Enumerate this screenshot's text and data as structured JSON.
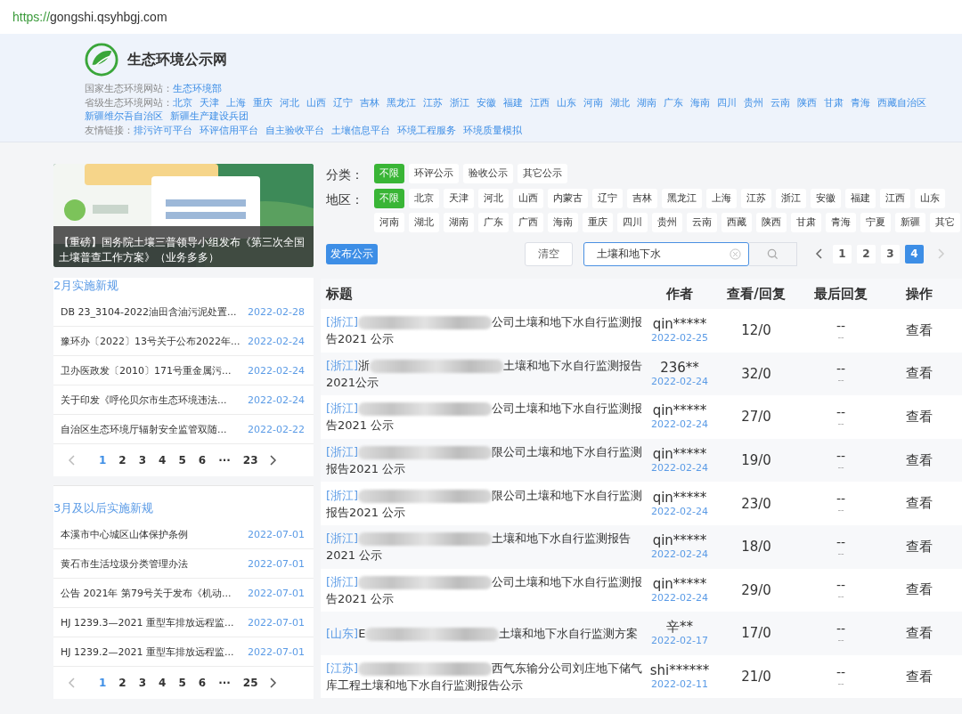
{
  "address_bar": {
    "scheme": "https://",
    "host": "gongshi.qsyhbgj.com"
  },
  "header": {
    "site_title": "生态环境公示网",
    "link_rows": [
      {
        "label": "国家生态环境网站：",
        "links": [
          "生态环境部"
        ]
      },
      {
        "label": "省级生态环境网站：",
        "links": [
          "北京",
          "天津",
          "上海",
          "重庆",
          "河北",
          "山西",
          "辽宁",
          "吉林",
          "黑龙江",
          "江苏",
          "浙江",
          "安徽",
          "福建",
          "江西",
          "山东",
          "河南",
          "湖北",
          "湖南",
          "广东",
          "海南",
          "四川",
          "贵州",
          "云南",
          "陕西",
          "甘肃",
          "青海",
          "西藏自治区",
          "新疆维尔吾自治区",
          "新疆生产建设兵团"
        ]
      },
      {
        "label": "友情链接：",
        "links": [
          "排污许可平台",
          "环评信用平台",
          "自主验收平台",
          "土壤信息平台",
          "环境工程服务",
          "环境质量模拟"
        ]
      }
    ]
  },
  "banner": {
    "caption": "【重磅】国务院土壤三普领导小组发布《第三次全国土壤普查工作方案》（业务多多）"
  },
  "sections": [
    {
      "title": "2月实施新规",
      "items": [
        {
          "title": "DB 23_3104-2022油田含油污泥处置...",
          "date": "2022-02-28"
        },
        {
          "title": "豫环办〔2022〕13号关于公布2022年...",
          "date": "2022-02-24"
        },
        {
          "title": "卫办医政发〔2010〕171号重金属污...",
          "date": "2022-02-24"
        },
        {
          "title": "关于印发《呼伦贝尔市生态环境违法...",
          "date": "2022-02-24"
        },
        {
          "title": "自治区生态环境厅辐射安全监管双随...",
          "date": "2022-02-22"
        }
      ],
      "pages": [
        {
          "label": "1",
          "selected": true
        },
        {
          "label": "2",
          "selected": false
        },
        {
          "label": "3",
          "selected": false
        },
        {
          "label": "4",
          "selected": false
        },
        {
          "label": "5",
          "selected": false
        },
        {
          "label": "6",
          "selected": false
        },
        {
          "label": "···",
          "selected": false
        },
        {
          "label": "23",
          "selected": false
        }
      ]
    },
    {
      "title": "3月及以后实施新规",
      "items": [
        {
          "title": "本溪市中心城区山体保护条例",
          "date": "2022-07-01"
        },
        {
          "title": "黄石市生活垃圾分类管理办法",
          "date": "2022-07-01"
        },
        {
          "title": "公告 2021年 第79号关于发布《机动...",
          "date": "2022-07-01"
        },
        {
          "title": "HJ 1239.3—2021 重型车排放远程监...",
          "date": "2022-07-01"
        },
        {
          "title": "HJ 1239.2—2021 重型车排放远程监...",
          "date": "2022-07-01"
        }
      ],
      "pages": [
        {
          "label": "1",
          "selected": true
        },
        {
          "label": "2",
          "selected": false
        },
        {
          "label": "3",
          "selected": false
        },
        {
          "label": "4",
          "selected": false
        },
        {
          "label": "5",
          "selected": false
        },
        {
          "label": "6",
          "selected": false
        },
        {
          "label": "···",
          "selected": false
        },
        {
          "label": "25",
          "selected": false
        }
      ]
    }
  ],
  "filters": [
    {
      "label": "分类：",
      "options": [
        {
          "label": "不限",
          "selected": true
        },
        {
          "label": "环评公示",
          "selected": false
        },
        {
          "label": "验收公示",
          "selected": false
        },
        {
          "label": "其它公示",
          "selected": false
        }
      ]
    },
    {
      "label": "地区：",
      "options": [
        {
          "label": "不限",
          "selected": true
        },
        {
          "label": "北京",
          "selected": false
        },
        {
          "label": "天津",
          "selected": false
        },
        {
          "label": "河北",
          "selected": false
        },
        {
          "label": "山西",
          "selected": false
        },
        {
          "label": "内蒙古",
          "selected": false
        },
        {
          "label": "辽宁",
          "selected": false
        },
        {
          "label": "吉林",
          "selected": false
        },
        {
          "label": "黑龙江",
          "selected": false
        },
        {
          "label": "上海",
          "selected": false
        },
        {
          "label": "江苏",
          "selected": false
        },
        {
          "label": "浙江",
          "selected": false
        },
        {
          "label": "安徽",
          "selected": false
        },
        {
          "label": "福建",
          "selected": false
        },
        {
          "label": "江西",
          "selected": false
        },
        {
          "label": "山东",
          "selected": false
        },
        {
          "label": "河南",
          "selected": false
        },
        {
          "label": "湖北",
          "selected": false
        },
        {
          "label": "湖南",
          "selected": false
        },
        {
          "label": "广东",
          "selected": false
        },
        {
          "label": "广西",
          "selected": false
        },
        {
          "label": "海南",
          "selected": false
        },
        {
          "label": "重庆",
          "selected": false
        },
        {
          "label": "四川",
          "selected": false
        },
        {
          "label": "贵州",
          "selected": false
        },
        {
          "label": "云南",
          "selected": false
        },
        {
          "label": "西藏",
          "selected": false
        },
        {
          "label": "陕西",
          "selected": false
        },
        {
          "label": "甘肃",
          "selected": false
        },
        {
          "label": "青海",
          "selected": false
        },
        {
          "label": "宁夏",
          "selected": false
        },
        {
          "label": "新疆",
          "selected": false
        },
        {
          "label": "其它",
          "selected": false
        }
      ]
    }
  ],
  "publish_button": "发布公示",
  "clear_button": "清空",
  "search": {
    "value": "土壤和地下水"
  },
  "pager": [
    {
      "label": "1",
      "selected": false
    },
    {
      "label": "2",
      "selected": false
    },
    {
      "label": "3",
      "selected": false
    },
    {
      "label": "4",
      "selected": true
    }
  ],
  "table": {
    "columns": [
      "标题",
      "作者",
      "查看/回复",
      "最后回复",
      "操作"
    ],
    "rows": [
      {
        "region": "[浙江]",
        "tail": "公司土壤和地下水自行监测报告2021 公示",
        "author": "qin*****",
        "date": "2022-02-25",
        "views": "12/0",
        "last_reply": "--",
        "last_reply_date": "--",
        "action": "查看"
      },
      {
        "region": "[浙江]",
        "lead": "浙",
        "tail": "土壤和地下水自行监测报告2021公示",
        "author": "236**",
        "date": "2022-02-24",
        "views": "32/0",
        "last_reply": "--",
        "last_reply_date": "--",
        "action": "查看"
      },
      {
        "region": "[浙江]",
        "tail": "公司土壤和地下水自行监测报告2021 公示",
        "author": "qin*****",
        "date": "2022-02-24",
        "views": "27/0",
        "last_reply": "--",
        "last_reply_date": "--",
        "action": "查看"
      },
      {
        "region": "[浙江]",
        "tail": "限公司土壤和地下水自行监测报告2021 公示",
        "author": "qin*****",
        "date": "2022-02-24",
        "views": "19/0",
        "last_reply": "--",
        "last_reply_date": "--",
        "action": "查看"
      },
      {
        "region": "[浙江]",
        "tail": "限公司土壤和地下水自行监测报告2021 公示",
        "author": "qin*****",
        "date": "2022-02-24",
        "views": "23/0",
        "last_reply": "--",
        "last_reply_date": "--",
        "action": "查看"
      },
      {
        "region": "[浙江]",
        "tail": "土壤和地下水自行监测报告2021 公示",
        "author": "qin*****",
        "date": "2022-02-24",
        "views": "18/0",
        "last_reply": "--",
        "last_reply_date": "--",
        "action": "查看"
      },
      {
        "region": "[浙江]",
        "tail": "公司土壤和地下水自行监测报告2021 公示",
        "author": "qin*****",
        "date": "2022-02-24",
        "views": "29/0",
        "last_reply": "--",
        "last_reply_date": "--",
        "action": "查看"
      },
      {
        "region": "[山东]",
        "lead": "E",
        "tail": "土壤和地下水自行监测方案",
        "author": "辛**",
        "date": "2022-02-17",
        "views": "17/0",
        "last_reply": "--",
        "last_reply_date": "--",
        "action": "查看"
      },
      {
        "region": "[江苏]",
        "tail": "西气东输分公司刘庄地下储气库工程土壤和地下水自行监测报告公示",
        "author": "shi******",
        "date": "2022-02-11",
        "views": "21/0",
        "last_reply": "--",
        "last_reply_date": "--",
        "action": "查看"
      }
    ]
  }
}
